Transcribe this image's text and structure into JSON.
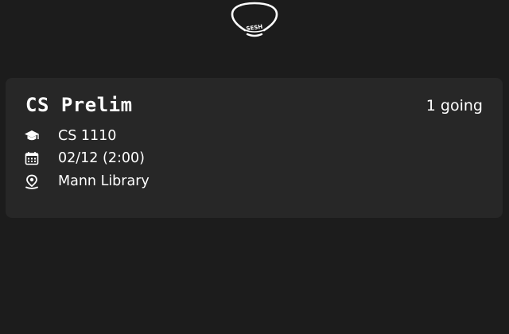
{
  "app": {
    "logo_text": "SESH",
    "logo_icon": "lightbulb-icon"
  },
  "session": {
    "title": "CS Prelim",
    "attendance": "1 going",
    "course": "CS 1110",
    "course_icon": "graduation-cap-icon",
    "datetime": "02/12 (2:00)",
    "datetime_icon": "calendar-icon",
    "location": "Mann Library",
    "location_icon": "location-pin-icon"
  },
  "colors": {
    "background": "#1c1c1c",
    "card": "#272727",
    "text": "#ffffff"
  }
}
